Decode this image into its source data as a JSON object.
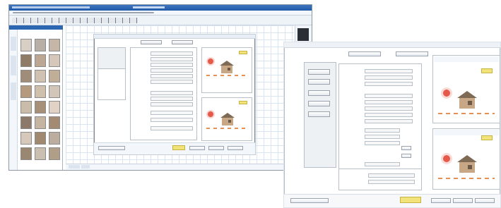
{
  "screen": {
    "accent": "#1f5aa6",
    "grid_color": "#d9e6f2",
    "thumbnail_colors": [
      "#c9b8a2",
      "#b5a08a",
      "#d7c6b2",
      "#8f7b66",
      "#a89580",
      "#c4b09a",
      "#e0d2c2",
      "#9c8872"
    ]
  },
  "layout": {
    "back_window": "drawing-software",
    "front_window": "energy-calculation-dialog"
  },
  "icons": {
    "house": "house-icon",
    "sun": "sun-icon",
    "highlight_button": "yellow-highlight-button"
  }
}
